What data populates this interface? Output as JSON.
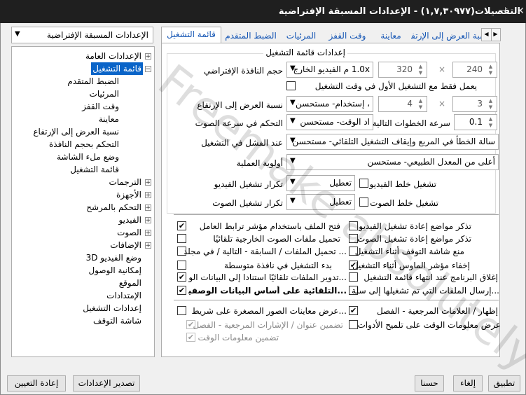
{
  "window": {
    "title": "التفصيلات(١,٧,٣٠٩٧٧) - الإعدادات المسبقة الإفتراضية",
    "icons": {
      "close": "close-icon",
      "pin": "pin-icon"
    }
  },
  "preset": {
    "value": "الإعدادات المسبقة الإفتراضية"
  },
  "tree": {
    "items": [
      {
        "label": "الإعدادات العامة"
      },
      {
        "label": "قائمة التشغيل"
      },
      {
        "label": "الضبط المتقدم"
      },
      {
        "label": "المرئيات"
      },
      {
        "label": "وقت القفز"
      },
      {
        "label": "معاينة"
      },
      {
        "label": "نسبة العرض إلى الإرتفاع"
      },
      {
        "label": "التحكم بحجم النافذة"
      },
      {
        "label": "وضع ملء الشاشة"
      },
      {
        "label": "قائمة التشغيل"
      },
      {
        "label": "الترجمات"
      },
      {
        "label": "الأجهزة"
      },
      {
        "label": "التحكم بالمرشح"
      },
      {
        "label": "الفيديو"
      },
      {
        "label": "الصوت"
      },
      {
        "label": "الإضافات"
      },
      {
        "label": "وضع الفيديو 3D"
      },
      {
        "label": "إمكانية الوصول"
      },
      {
        "label": "الموقع"
      },
      {
        "label": "الإمتدادات"
      },
      {
        "label": "إعدادات التشغيل"
      },
      {
        "label": "شاشة التوقف"
      }
    ]
  },
  "tabs": [
    {
      "label": "قائمة التشغيل"
    },
    {
      "label": "الضبط المتقدم"
    },
    {
      "label": "المرئيات"
    },
    {
      "label": "وقت القفز"
    },
    {
      "label": "معاينة"
    },
    {
      "label": "نسبة العرض إلى الإرتفاع"
    }
  ],
  "settings": {
    "group_title": "إعدادات قائمة التشغيل",
    "window_size": {
      "label": "حجم النافذة الإفتراضي",
      "combo": "1.0x م الفيديو الخارج",
      "w": "320",
      "times": "×",
      "h": "240"
    },
    "first_only": {
      "label": "يعمل فقط مع التشغيل الأول في وقت التشغيل"
    },
    "aspect": {
      "label": "نسبة العرض إلى الإرتفاع",
      "combo": "، إستخدام- مستحسن",
      "w": "4",
      "times": "×",
      "h": "3"
    },
    "speed": {
      "label": "التحكم في سرعة الصوت",
      "combo": "اد الوقت- مستحسن",
      "step_label": "سرعة الخطوات التالية",
      "step": "0.1"
    },
    "onfail": {
      "label": "عند الفشل في التشغيل",
      "combo": "سالة الخطأ في المربع وإيقاف التشغيل التلقائي- مستحسن"
    },
    "priority": {
      "label": "أولوية العملية",
      "combo": "أعلى من المعدل الطبيعي- مستحسن"
    },
    "video_repeat": {
      "label": "تكرار تشغيل الفيديو",
      "combo": "تعطيل",
      "shuffle": "تشغيل خلط الفيديو"
    },
    "audio_repeat": {
      "label": "تكرار تشغيل الصوت",
      "combo": "تعطيل",
      "shuffle": "تشغيل خلط الصوت"
    }
  },
  "checks_right": [
    {
      "label": "تذكر مواضع إعادة تشغيل الفيديو",
      "checked": false
    },
    {
      "label": "تذكر مواضع إعادة تشغيل الصوت",
      "checked": false
    },
    {
      "label": "منع شاشة التوقف أثناء التشغيل",
      "checked": false
    },
    {
      "label": "إخفاء مؤشر الماوس أثناء التشغيل",
      "checked": true
    },
    {
      "label": "إغلاق البرنامج عند انتهاء قائمة التشغيل",
      "checked": false
    },
    {
      "label": "...إرسال الملفات التي تم تشغيلها إلى سلة",
      "checked": false
    }
  ],
  "checks_left": [
    {
      "label": "فتح الملف باستخدام مؤشر ترابط العامل",
      "checked": true
    },
    {
      "label": "تحميل ملفات الصوت الخارجية تلقائيًا",
      "checked": false
    },
    {
      "label": "... تحميل الملفات / السابقة - التالية / في مجلد",
      "checked": false
    },
    {
      "label": "بدء التشغيل في نافذة متوسطة",
      "checked": false
    },
    {
      "label": "...تدوير الملفات تلقائيًا استنادا إلى البيانات الو",
      "checked": true
    },
    {
      "label": "...التلقائية على أساس البيانات الوصفية retitl",
      "checked": true,
      "bold": true
    }
  ],
  "checks_bottom": {
    "chapters": {
      "label": "إظهار / العلامات المرجعية - الفصل",
      "checked": true
    },
    "tooltip_time": {
      "label": "عرض معلومات الوقت على تلميح الأدوات",
      "checked": false
    },
    "thumbs": {
      "label": "...عرض معاينات الصور المصغرة على شريط ا",
      "checked": false
    },
    "include_title": {
      "label": "تضمين عنوان / الإشارات المرجعية - الفصل",
      "checked": true
    },
    "include_time": {
      "label": "تضمين معلومات الوقت",
      "checked": true
    }
  },
  "buttons": {
    "apply": "تطبيق",
    "cancel": "إلغاء",
    "ok": "حسنا",
    "export": "تصدير الإعدادات",
    "reset": "إعادة التعيين"
  },
  "watermark": "Freemake absolutely"
}
